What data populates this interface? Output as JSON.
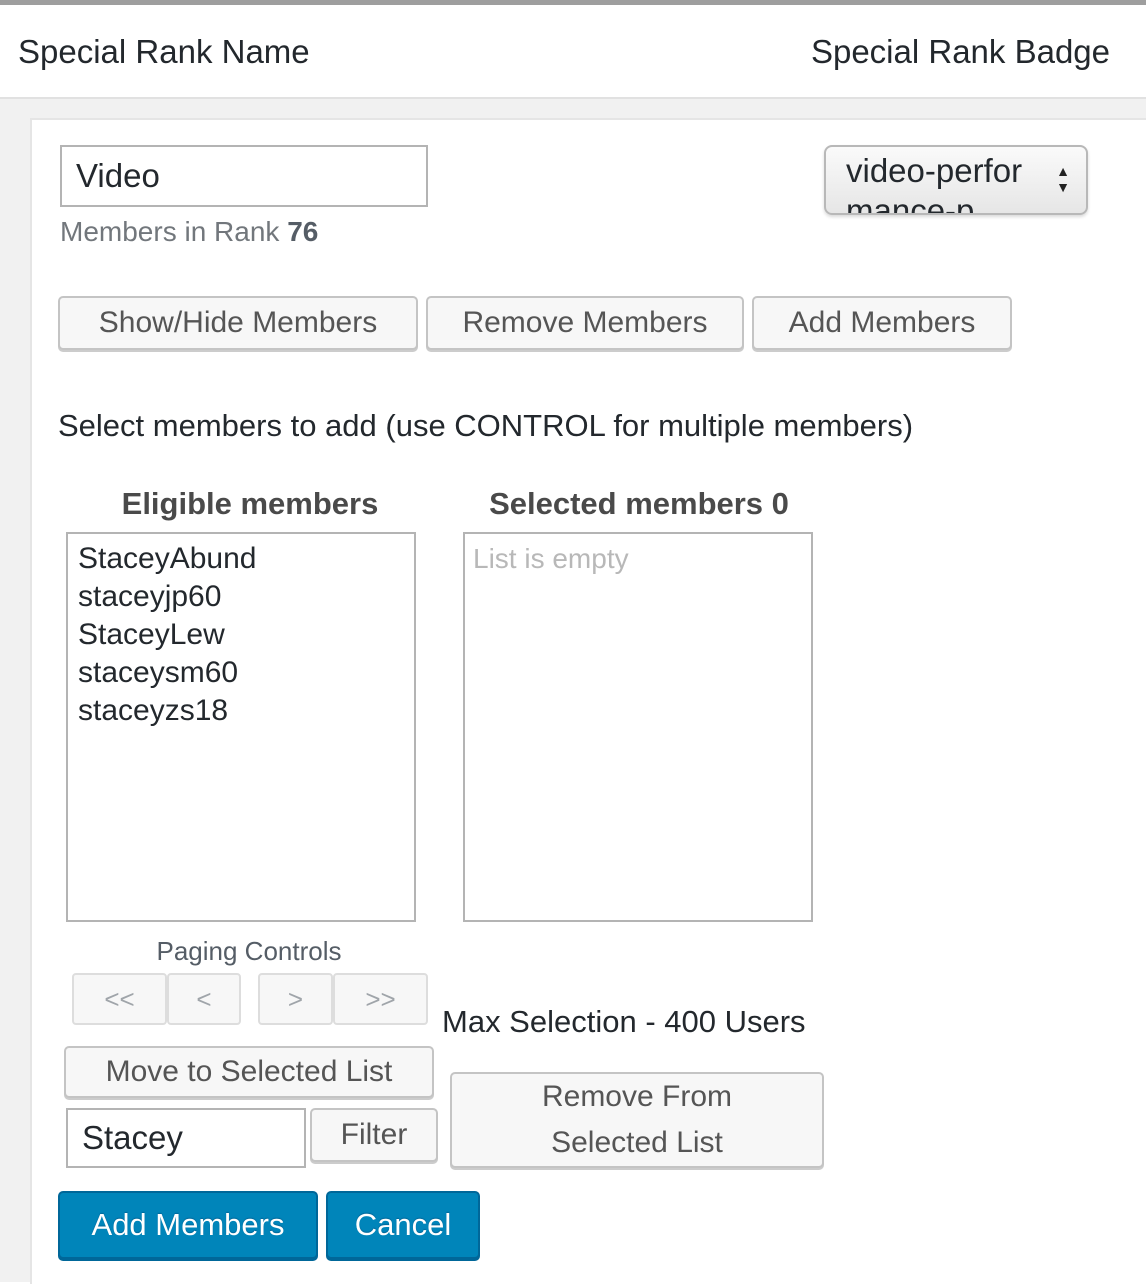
{
  "table_header": {
    "name_column": "Special Rank Name",
    "badge_column": "Special Rank Badge"
  },
  "rank": {
    "name_value": "Video",
    "members_label": "Members in Rank",
    "members_count": "76",
    "badge_select_value": "video-performance-p"
  },
  "actions": {
    "show_hide": "Show/Hide Members",
    "remove": "Remove Members",
    "add": "Add Members"
  },
  "instructions": "Select members to add (use CONTROL for multiple members)",
  "eligible": {
    "heading": "Eligible members",
    "items": [
      "StaceyAbund",
      "staceyjp60",
      "StaceyLew",
      "staceysm60",
      "staceyzs18"
    ]
  },
  "selected": {
    "heading": "Selected members 0",
    "empty_text": "List is empty"
  },
  "paging": {
    "label": "Paging Controls",
    "first": "<<",
    "prev": "<",
    "next": ">",
    "last": ">>"
  },
  "max_selection": "Max Selection - 400 Users",
  "move_to_selected": "Move to Selected List",
  "filter": {
    "value": "Stacey",
    "button": "Filter"
  },
  "remove_from_selected": {
    "line1": "Remove From",
    "line2": "Selected List"
  },
  "footer": {
    "add_members": "Add Members",
    "cancel": "Cancel"
  },
  "colors": {
    "primary": "#0085ba",
    "primary_border": "#006799",
    "text": "#23282d",
    "muted": "#72777c"
  }
}
